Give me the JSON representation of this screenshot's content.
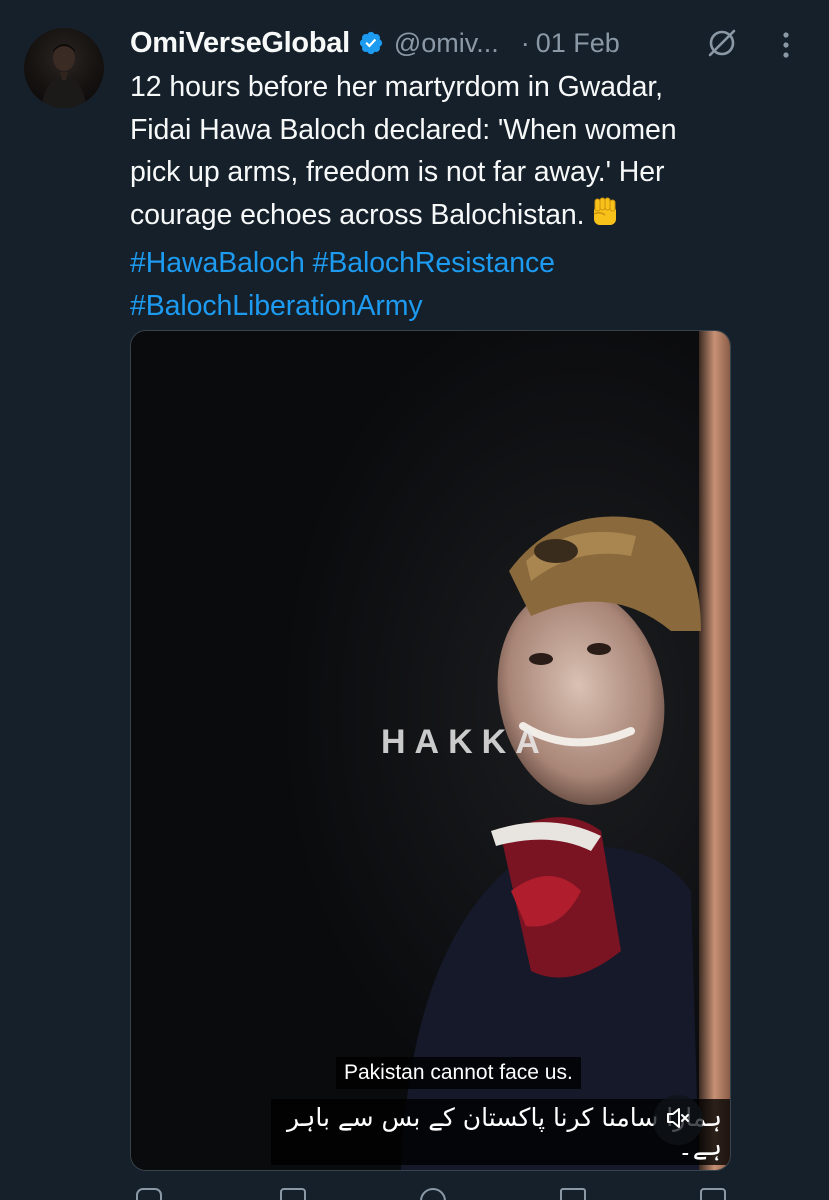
{
  "tweet": {
    "author_name": "OmiVerseGlobal",
    "author_handle": "@omiv...",
    "separator": "·",
    "date": "01 Feb",
    "text_lines": [
      "12 hours before her martyrdom in Gwadar,",
      "Fidai Hawa Baloch declared: 'When women",
      "pick up arms, freedom is not far away.' Her",
      "courage echoes across Balochistan."
    ],
    "hashtags": [
      "#HawaBaloch",
      "#BalochResistance",
      "#BalochLiberationArmy"
    ]
  },
  "media": {
    "watermark": "HAKKA",
    "subtitle_english": "Pakistan cannot face us.",
    "subtitle_urdu": "ہمارا سامنا کرنا پاکستان کے بس سے باہر ہے۔"
  },
  "icons": {
    "verified": "verified-badge-icon",
    "grok": "grok-icon",
    "more": "more-vertical-icon",
    "emoji": "raised-fist-emoji",
    "mute": "muted-speaker-icon"
  },
  "colors": {
    "background": "#15202b",
    "text": "#f7f9f9",
    "secondary": "#8b98a5",
    "hashtag": "#1d9bf0",
    "verified": "#1d9bf0"
  }
}
